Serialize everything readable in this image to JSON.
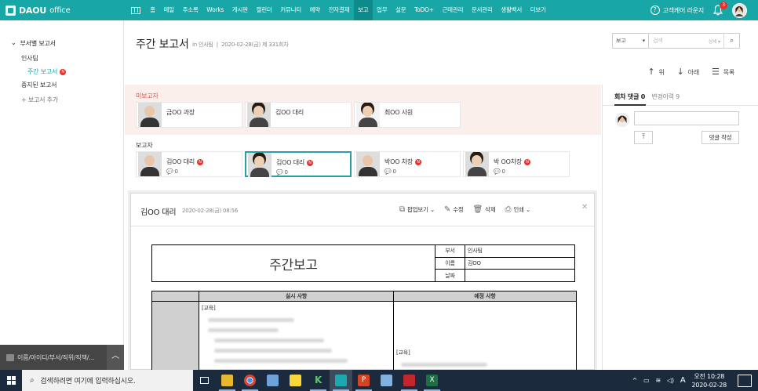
{
  "app": {
    "logo": "DAOU",
    "logo_sub": "office"
  },
  "menu": [
    "홈",
    "메일",
    "주소록",
    "Works",
    "게시판",
    "캘린더",
    "커뮤니티",
    "예약",
    "전자결재",
    "보고",
    "업무",
    "설문",
    "ToDO+",
    "근태관리",
    "문서관리",
    "생활백서",
    "더보기"
  ],
  "menu_active": "보고",
  "topright": {
    "help": "고객케어 라운지",
    "bell_count": "3"
  },
  "sidebar": {
    "header": "부서별 보고서",
    "dept": "인사팀",
    "selected": "주간 보고서",
    "badge": "N",
    "stopped": "중지된 보고서",
    "add": "보고서 추가"
  },
  "search_bar": {
    "placeholder": "이름/아이디/부서/직위/직책/..."
  },
  "page": {
    "title": "주간 보고서",
    "meta_dept": "in 인사팀",
    "meta_date": "2020-02-28(금) 제 331회차"
  },
  "search": {
    "select": "보고",
    "placeholder": "검색",
    "detail": "상세 ▾"
  },
  "nav": {
    "up": "위",
    "down": "아래",
    "list": "목록"
  },
  "unreported": {
    "label": "미보고자",
    "people": [
      {
        "name": "금OO 과장"
      },
      {
        "name": "김OO 대리"
      },
      {
        "name": "최OO 사원"
      }
    ]
  },
  "reporters": {
    "label": "보고자",
    "people": [
      {
        "name": "김OO 대리",
        "comments": "0"
      },
      {
        "name": "김OO 대리",
        "comments": "0"
      },
      {
        "name": "박OO 차장",
        "comments": "0"
      },
      {
        "name": "박 OO차장",
        "comments": "0"
      }
    ]
  },
  "comments": {
    "tab_on": "회차 댓글 0",
    "tab_off": "변경이력 9",
    "write": "댓글 작성"
  },
  "report": {
    "author": "김OO 대리",
    "date": "2020-02-28(금) 08:56",
    "tools": [
      "팝업보기",
      "수정",
      "삭제",
      "인쇄"
    ],
    "doc_title": "주간보고",
    "info": [
      {
        "k": "부서",
        "v": "인사팀"
      },
      {
        "k": "이름",
        "v": "김OO"
      },
      {
        "k": "날짜",
        "v": ""
      }
    ],
    "col_done": "실시 사항",
    "col_plan": "예정 사항",
    "edu": "[교육]",
    "edu2": "[교육]"
  },
  "taskbar": {
    "search": "검색하려면 여기에 입력하십시오.",
    "time": "오전 10:28",
    "date": "2020-02-28",
    "ime": "A"
  }
}
